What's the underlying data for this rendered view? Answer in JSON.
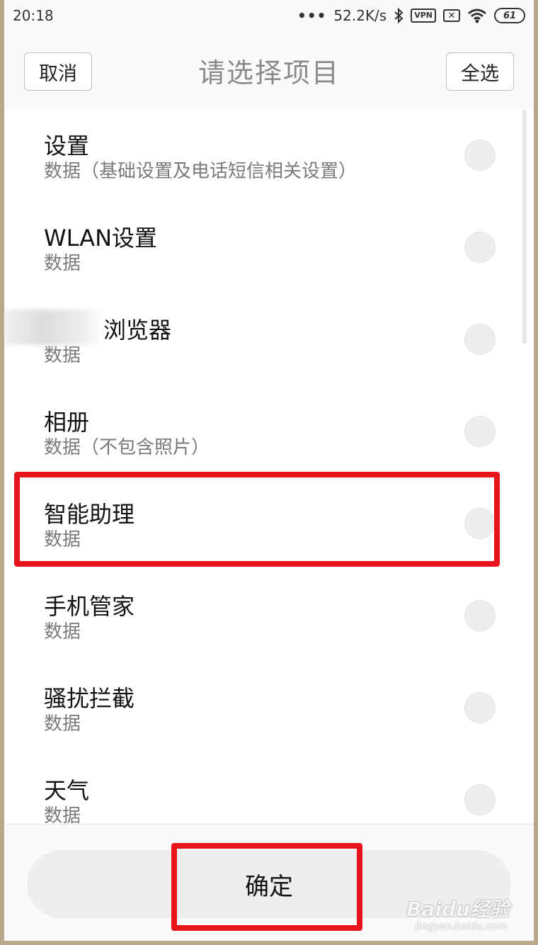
{
  "status_bar": {
    "time": "20:18",
    "dots": "•••",
    "speed": "52.2K/s",
    "bluetooth_icon": "bluetooth-icon",
    "vpn": "VPN",
    "sim_icon": "sim-x-icon",
    "sim_text": "✕",
    "wifi_icon": "wifi-icon",
    "battery": "61"
  },
  "header": {
    "cancel_label": "取消",
    "title": "请选择项目",
    "select_all_label": "全选"
  },
  "items": [
    {
      "title": "设置",
      "subtitle": "数据（基础设置及电话短信相关设置）"
    },
    {
      "title": "WLAN设置",
      "subtitle": "数据"
    },
    {
      "title": "浏览器",
      "subtitle": "数据"
    },
    {
      "title": "相册",
      "subtitle": "数据（不包含照片）"
    },
    {
      "title": "智能助理",
      "subtitle": "数据"
    },
    {
      "title": "手机管家",
      "subtitle": "数据"
    },
    {
      "title": "骚扰拦截",
      "subtitle": "数据"
    },
    {
      "title": "天气",
      "subtitle": "数据"
    }
  ],
  "footer": {
    "confirm_label": "确定"
  },
  "watermark": {
    "brand": "Baidu经验",
    "url": "jingyan.baidu.com"
  },
  "colors": {
    "highlight": "#e8141c",
    "frame": "#b9a88a"
  }
}
